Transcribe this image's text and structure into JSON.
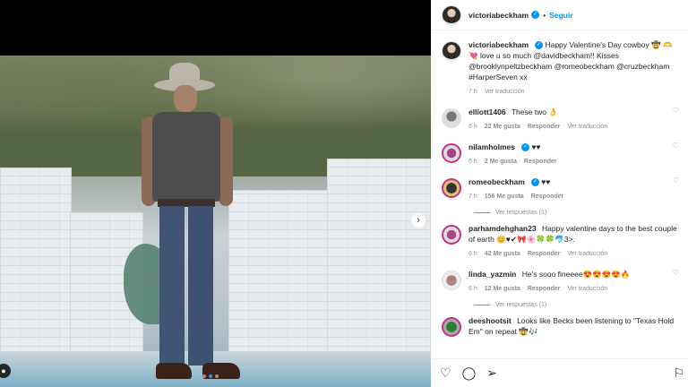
{
  "post": {
    "author": "victoriabeckham",
    "follow_label": "Seguir",
    "more_icon": "more-horizontal-icon"
  },
  "caption": {
    "author": "victoriabeckham",
    "text": "Happy Valentine's Day cowboy 🤠 🫶 💘 love u so much @davidbeckham!! Kisses @brooklynpeltzbeckham @romeobeckham @cruzbeckham #HarperSeven xx",
    "time": "7 h",
    "translate": "Ver traducción"
  },
  "comments": [
    {
      "user": "elliott1406",
      "text": "These two 👌",
      "time": "6 h",
      "likes": "22 Me gusta",
      "reply": "Responder",
      "translate": "Ver traducción",
      "verified": false
    },
    {
      "user": "nilamholmes",
      "text": "♥♥",
      "time": "6 h",
      "likes": "2 Me gusta",
      "reply": "Responder",
      "translate": "",
      "verified": true
    },
    {
      "user": "romeobeckham",
      "text": "♥♥",
      "time": "7 h",
      "likes": "156 Me gusta",
      "reply": "Responder",
      "translate": "",
      "verified": true,
      "replies": "Ver respuestas (1)"
    },
    {
      "user": "parhamdehghan23",
      "text": "Happy valentine days to the best couple of earth 😊♥✔🎀🌸🍀🍀🐬3>.",
      "time": "6 h",
      "likes": "42 Me gusta",
      "reply": "Responder",
      "translate": "Ver traducción",
      "verified": false
    },
    {
      "user": "linda_yazmin",
      "text": "He's sooo fineeee😍😍😍😍🔥",
      "time": "6 h",
      "likes": "12 Me gusta",
      "reply": "Responder",
      "translate": "Ver traducción",
      "verified": false,
      "replies": "Ver respuestas (1)"
    },
    {
      "user": "deeshootsit",
      "text": "Looks like Becks been listening to \"Texas Hold Em\" on repeat 🤠🎶",
      "time": "",
      "likes": "",
      "reply": "",
      "translate": "",
      "verified": false
    }
  ],
  "carousel": {
    "total_dots": 3,
    "active_dot": 1
  }
}
